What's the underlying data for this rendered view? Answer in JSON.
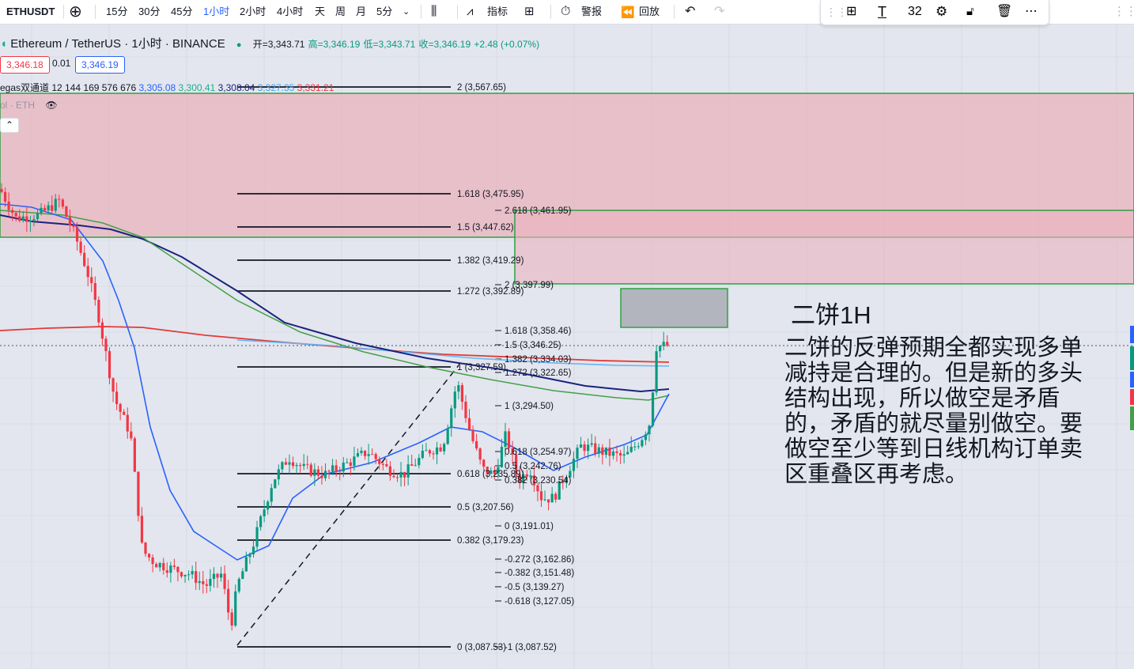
{
  "toolbar": {
    "symbol": "ETHUSDT",
    "intervals": [
      "15分",
      "30分",
      "45分",
      "1小时",
      "2小时",
      "4小时",
      "天",
      "周",
      "月",
      "5分"
    ],
    "active_interval": "1小时",
    "indicators_label": "指标",
    "alert_label": "警报",
    "replay_label": "回放"
  },
  "drawing_toolbar": {
    "font_size": "32"
  },
  "legend": {
    "title": "Ethereum / TetherUS · 1小时 · BINANCE",
    "open": "开=3,343.71",
    "high": "高=3,346.19",
    "low": "低=3,343.71",
    "close": "收=3,346.19",
    "change": "+2.48 (+0.07%)",
    "bid": "3,346.18",
    "spread": "0.01",
    "ask": "3,346.19",
    "vegas_label": "egas双通道 12 144 169 576 676",
    "vegas_values": [
      {
        "v": "3,305.08",
        "c": "#2962ff"
      },
      {
        "v": "3,300.41",
        "c": "#22ab94"
      },
      {
        "v": "3,308.04",
        "c": "#1a237e"
      },
      {
        "v": "3,327.35",
        "c": "#42a5f5"
      },
      {
        "v": "3,331.21",
        "c": "#f23645"
      }
    ],
    "vol_label": "ol · ETH"
  },
  "colors": {
    "up": "#089981",
    "down": "#f23645",
    "zone": "#e9b3be",
    "fib": "#131722",
    "box_border": "#2ea043"
  },
  "fib_a": [
    {
      "ratio": "2",
      "price": "3,567.65"
    },
    {
      "ratio": "1.618",
      "price": "3,475.95"
    },
    {
      "ratio": "1.5",
      "price": "3,447.62"
    },
    {
      "ratio": "1.382",
      "price": "3,419.29"
    },
    {
      "ratio": "1.272",
      "price": "3,392.89"
    },
    {
      "ratio": "1",
      "price": "3,327.59"
    },
    {
      "ratio": "0.618",
      "price": "3,235.89"
    },
    {
      "ratio": "0.5",
      "price": "3,207.56"
    },
    {
      "ratio": "0.382",
      "price": "3,179.23"
    },
    {
      "ratio": "0",
      "price": "3,087.53"
    }
  ],
  "fib_b": [
    {
      "ratio": "2.618",
      "price": "3,461.95"
    },
    {
      "ratio": "2",
      "price": "3,397.99"
    },
    {
      "ratio": "1.618",
      "price": "3,358.46"
    },
    {
      "ratio": "1.5",
      "price": "3,346.25"
    },
    {
      "ratio": "1.382",
      "price": "3,334.03"
    },
    {
      "ratio": "1.272",
      "price": "3,322.65"
    },
    {
      "ratio": "1",
      "price": "3,294.50"
    },
    {
      "ratio": "0.618",
      "price": "3,254.97"
    },
    {
      "ratio": "0.5",
      "price": "3,242.76"
    },
    {
      "ratio": "0.382",
      "price": "3,230.54"
    },
    {
      "ratio": "0",
      "price": "3,191.01"
    },
    {
      "ratio": "-0.272",
      "price": "3,162.86"
    },
    {
      "ratio": "-0.382",
      "price": "3,151.48"
    },
    {
      "ratio": "-0.5",
      "price": "3,139.27"
    },
    {
      "ratio": "-0.618",
      "price": "3,127.05"
    },
    {
      "ratio": "-1",
      "price": "3,087.52"
    }
  ],
  "annotation": {
    "title": "二饼1H",
    "text": "二饼的反弹预期全都实现多单减持是合理的。但是新的多头结构出现，所以做空是矛盾的，矛盾的就尽量别做空。要做空至少等到日线机构订单卖区重叠区再考虑。"
  }
}
